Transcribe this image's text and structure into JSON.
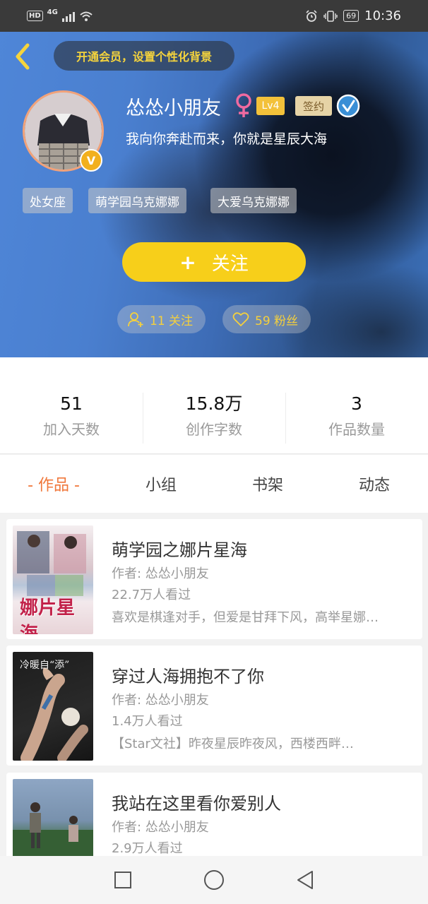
{
  "status_bar": {
    "hd": "HD",
    "network": "4G",
    "battery": "69",
    "time": "10:36"
  },
  "header": {
    "vip_banner": "开通会员，设置个性化背景"
  },
  "profile": {
    "username": "怂怂小朋友",
    "level": "Lv4",
    "sign_tag": "签约",
    "avatar_badge": "V",
    "bio": "我向你奔赴而来，你就是星辰大海",
    "tags": [
      "处女座",
      "萌学园乌克娜娜",
      "大爱乌克娜娜"
    ],
    "follow_button": "关注",
    "follow_button_plus": "+",
    "following_count": "11 关注",
    "fans_count": "59 粉丝"
  },
  "stats": [
    {
      "value": "51",
      "label": "加入天数"
    },
    {
      "value": "15.8万",
      "label": "创作字数"
    },
    {
      "value": "3",
      "label": "作品数量"
    }
  ],
  "tabs": [
    {
      "label": "- 作品 -",
      "active": true
    },
    {
      "label": "小组",
      "active": false
    },
    {
      "label": "书架",
      "active": false
    },
    {
      "label": "动态",
      "active": false
    }
  ],
  "works": [
    {
      "title": "萌学园之娜片星海",
      "author": "作者: 怂怂小朋友",
      "views": "22.7万人看过",
      "desc": "喜欢是棋逢对手，但爱是甘拜下风，高举星娜…",
      "cover_text": "娜片星海"
    },
    {
      "title": "穿过人海拥抱不了你",
      "author": "作者: 怂怂小朋友",
      "views": "1.4万人看过",
      "desc": "【Star文社】昨夜星辰昨夜风，西楼西畔…",
      "cover_text": "冷暖自“添”"
    },
    {
      "title": "我站在这里看你爱别人",
      "author": "作者: 怂怂小朋友",
      "views": "2.9万人看过",
      "desc": "",
      "cover_text": ""
    }
  ],
  "colors": {
    "accent_yellow": "#f7cf1a",
    "tab_active": "#f0773a",
    "level_tag": "#f3c13a"
  },
  "icons": {
    "back": "back-chevron-icon",
    "gender": "female-icon",
    "verify": "verified-check-icon",
    "follow_pill": "add-person-icon",
    "fans_pill": "heart-icon",
    "nav": [
      "recent-apps-icon",
      "home-icon",
      "back-icon"
    ]
  }
}
